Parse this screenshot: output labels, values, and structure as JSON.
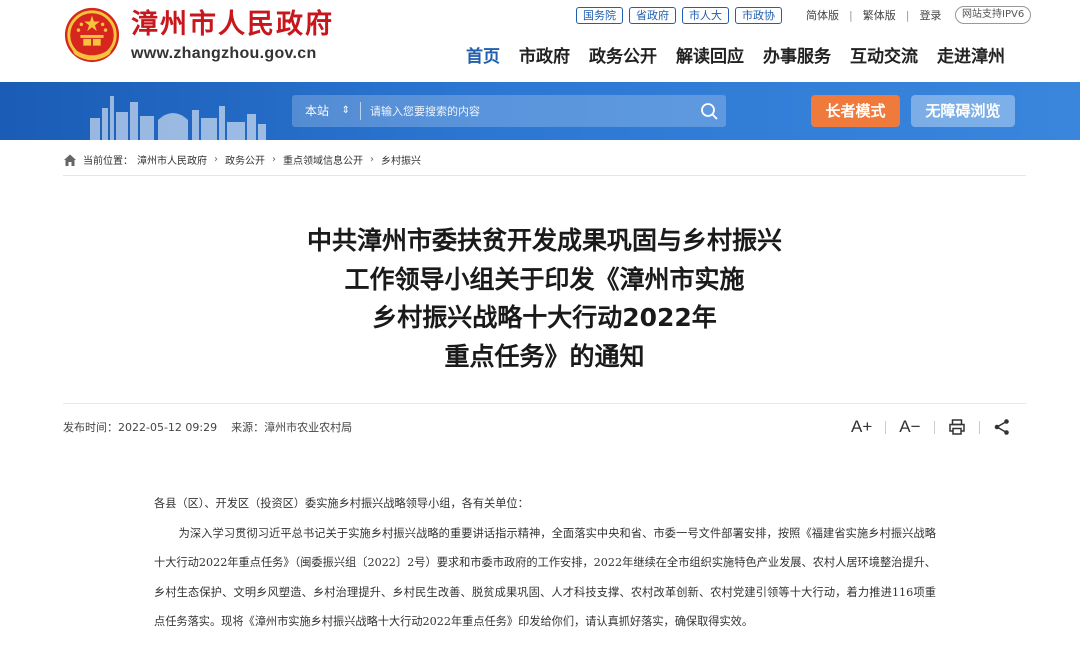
{
  "header": {
    "logo_title": "漳州市人民政府",
    "logo_url": "www.zhangzhou.gov.cn",
    "tag_links": [
      "国务院",
      "省政府",
      "市人大",
      "市政协"
    ],
    "util_links": [
      "简体版",
      "繁体版",
      "登录"
    ],
    "ipv6": "网站支持IPV6",
    "nav": [
      "首页",
      "市政府",
      "政务公开",
      "解读回应",
      "办事服务",
      "互动交流",
      "走进漳州"
    ]
  },
  "banner": {
    "search_scope": "本站",
    "search_placeholder": "请输入您要搜索的内容",
    "elder_mode": "长者模式",
    "accessible": "无障碍浏览"
  },
  "breadcrumb": {
    "label": "当前位置：",
    "items": [
      "漳州市人民政府",
      "政务公开",
      "重点领域信息公开",
      "乡村振兴"
    ]
  },
  "article": {
    "title_lines": [
      "中共漳州市委扶贫开发成果巩固与乡村振兴",
      "工作领导小组关于印发《漳州市实施",
      "乡村振兴战略十大行动2022年",
      "重点任务》的通知"
    ],
    "publish_label": "发布时间：",
    "publish_time": "2022-05-12 09:29",
    "source_label": "来源：",
    "source": "漳州市农业农村局",
    "tools": {
      "font_increase": "A+",
      "font_decrease": "A−"
    },
    "body": [
      "各县（区）、开发区（投资区）委实施乡村振兴战略领导小组，各有关单位：",
      "为深入学习贯彻习近平总书记关于实施乡村振兴战略的重要讲话指示精神，全面落实中央和省、市委一号文件部署安排，按照《福建省实施乡村振兴战略十大行动2022年重点任务》（闽委振兴组〔2022〕2号）要求和市委市政府的工作安排，2022年继续在全市组织实施特色产业发展、农村人居环境整治提升、乡村生态保护、文明乡风塑造、乡村治理提升、乡村民生改善、脱贫成果巩固、人才科技支撑、农村改革创新、农村党建引领等十大行动，着力推进116项重点任务落实。现将《漳州市实施乡村振兴战略十大行动2022年重点任务》印发给你们，请认真抓好落实，确保取得实效。"
    ]
  },
  "colors": {
    "brand_red": "#c8161d",
    "brand_blue": "#1f5fae",
    "elder_orange": "#f07a3c"
  }
}
